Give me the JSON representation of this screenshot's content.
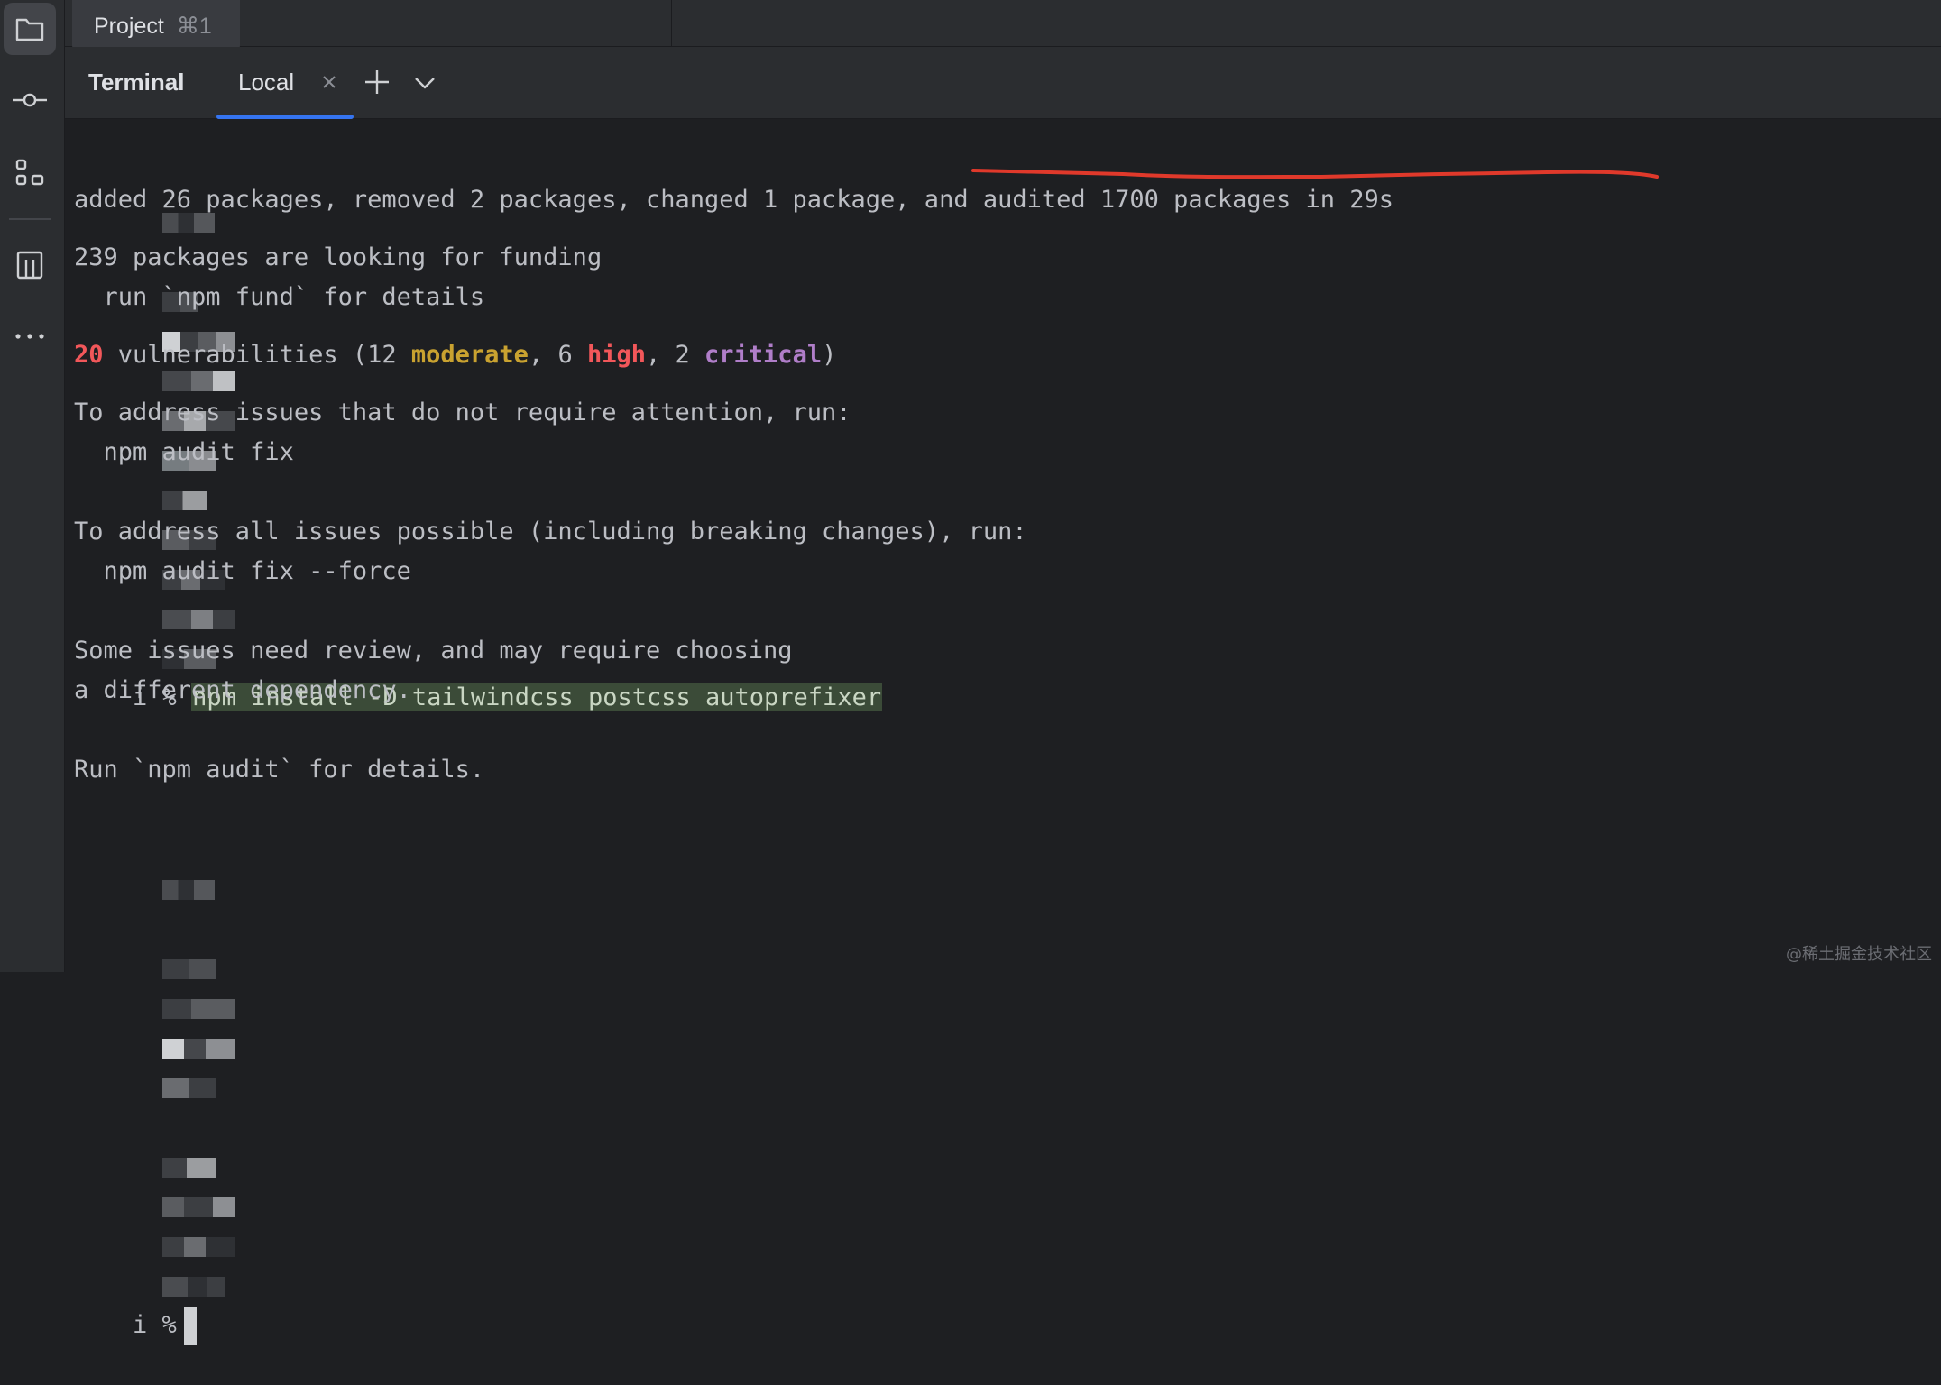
{
  "topbar": {
    "project_label": "Project",
    "project_shortcut": "⌘1"
  },
  "sidebar": {
    "icons": [
      "folder-icon",
      "commit-icon",
      "structure-icon",
      "bookmark-icon",
      "more-icon"
    ]
  },
  "tabbar": {
    "title": "Terminal",
    "tabs": [
      {
        "label": "Local",
        "active": true
      }
    ],
    "close_glyph": "×"
  },
  "terminal": {
    "prompt_suffix": "i %",
    "command": "npm install -D tailwindcss postcss autoprefixer",
    "lines": {
      "added": "added 26 packages, removed 2 packages, changed 1 package, and audited 1700 packages in 29s",
      "funding": "239 packages are looking for funding",
      "fund_cmd": "  run `npm fund` for details",
      "vuln": {
        "total": "20",
        "text1": " vulnerabilities (12 ",
        "moderate": "moderate",
        "text2": ", 6 ",
        "high": "high",
        "text3": ", 2 ",
        "critical": "critical",
        "text4": ")"
      },
      "address1": "To address issues that do not require attention, run:",
      "fix1": "  npm audit fix",
      "address2": "To address all issues possible (including breaking changes), run:",
      "fix2": "  npm audit fix --force",
      "review1": "Some issues need review, and may require choosing",
      "review2": "a different dependency.",
      "audit": "Run `npm audit` for details."
    }
  },
  "watermark": "@稀土掘金技术社区",
  "colors": {
    "accent": "#3574f0",
    "error": "#f2575a",
    "moderate": "#c9a230",
    "critical": "#b07ec9",
    "annotation": "#e0392b"
  }
}
